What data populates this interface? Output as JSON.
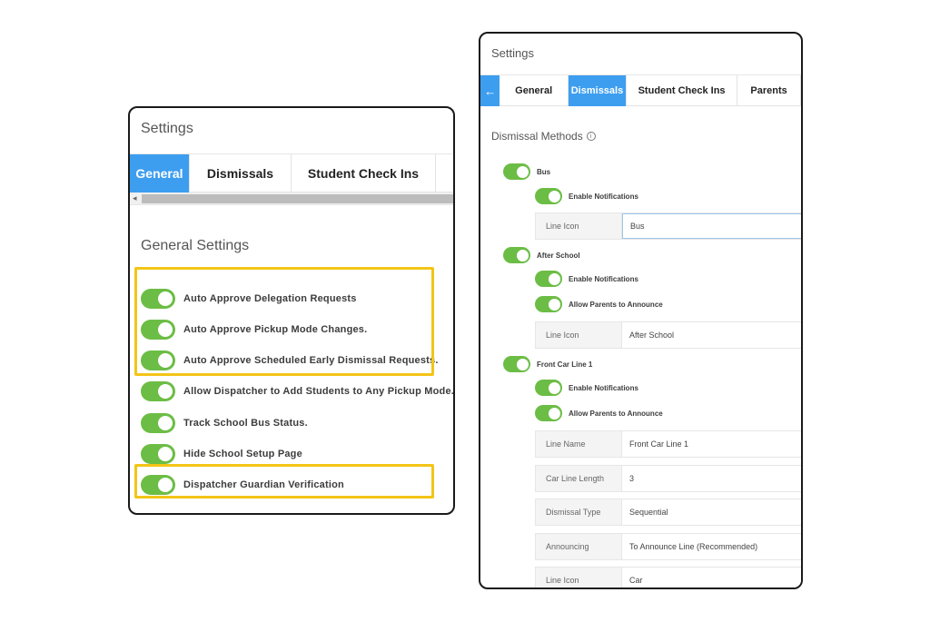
{
  "left_panel": {
    "title": "Settings",
    "tabs": [
      {
        "label": "General",
        "active": true
      },
      {
        "label": "Dismissals",
        "active": false
      },
      {
        "label": "Student Check Ins",
        "active": false
      }
    ],
    "section_title": "General Settings",
    "settings": [
      {
        "label": "Auto Approve Delegation Requests",
        "enabled": true
      },
      {
        "label": "Auto Approve Pickup Mode Changes.",
        "enabled": true
      },
      {
        "label": "Auto Approve Scheduled Early Dismissal Requests.",
        "enabled": true
      },
      {
        "label": "Allow Dispatcher to Add Students to Any Pickup Mode.",
        "enabled": true
      },
      {
        "label": "Track School Bus Status.",
        "enabled": true
      },
      {
        "label": "Hide School Setup Page",
        "enabled": true
      },
      {
        "label": "Dispatcher Guardian Verification",
        "enabled": true
      }
    ]
  },
  "right_panel": {
    "title": "Settings",
    "back_icon": "arrow-left-icon",
    "tabs": [
      {
        "label": "General",
        "active": false
      },
      {
        "label": "Dismissals",
        "active": true
      },
      {
        "label": "Student Check Ins",
        "active": false
      },
      {
        "label": "Parents",
        "active": false
      }
    ],
    "section_title": "Dismissal Methods",
    "section_info_glyph": "i",
    "methods": {
      "bus": {
        "label": "Bus",
        "enabled": true,
        "enable_notifications": "Enable Notifications",
        "line_icon_label": "Line Icon",
        "line_icon_value": "Bus"
      },
      "after_school": {
        "label": "After School",
        "enabled": true,
        "enable_notifications": "Enable Notifications",
        "allow_parents": "Allow Parents to Announce",
        "line_icon_label": "Line Icon",
        "line_icon_value": "After School"
      },
      "front_car_line": {
        "label": "Front Car Line 1",
        "enabled": true,
        "enable_notifications": "Enable Notifications",
        "allow_parents": "Allow Parents to Announce",
        "fields": [
          {
            "label": "Line Name",
            "value": "Front Car Line 1"
          },
          {
            "label": "Car Line Length",
            "value": "3"
          },
          {
            "label": "Dismissal Type",
            "value": "Sequential"
          },
          {
            "label": "Announcing",
            "value": "To Announce Line (Recommended)"
          },
          {
            "label": "Line Icon",
            "value": "Car"
          }
        ]
      }
    }
  },
  "colors": {
    "accent": "#3d9ef0",
    "toggle_on": "#6cbd45",
    "highlight": "#f3c516"
  }
}
